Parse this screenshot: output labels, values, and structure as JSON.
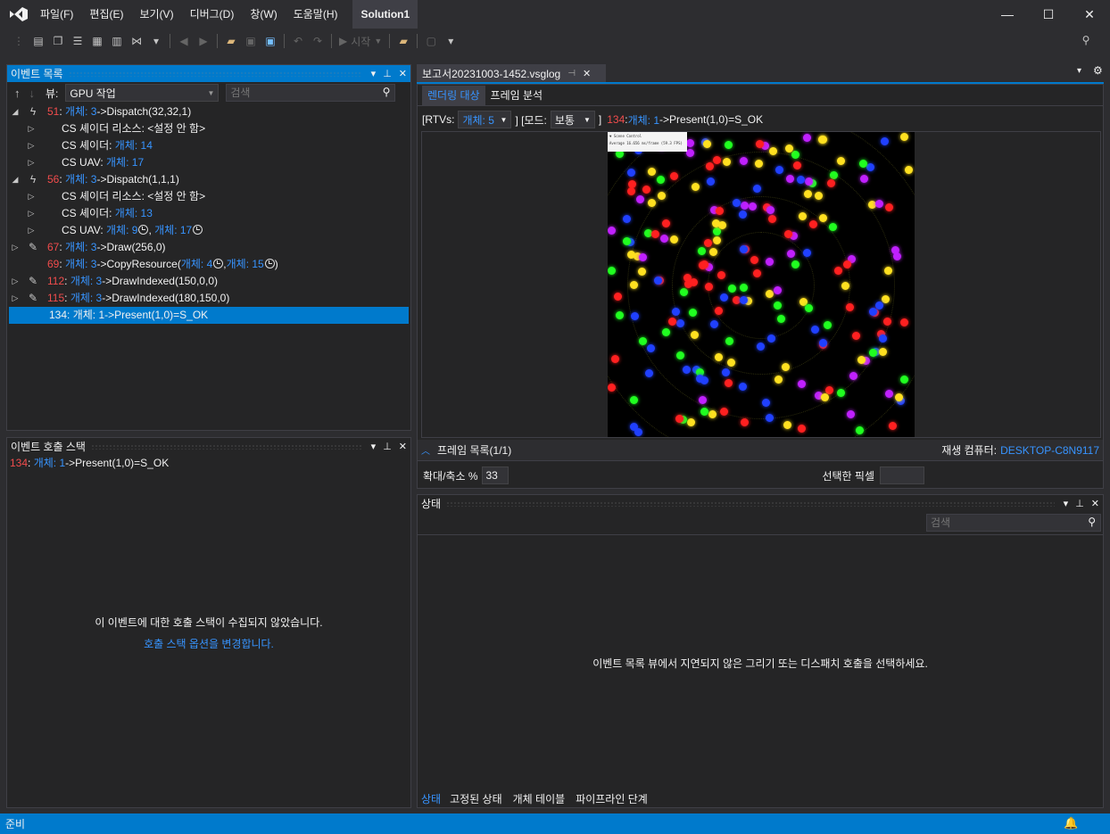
{
  "menu": [
    "파일(F)",
    "편집(E)",
    "보기(V)",
    "디버그(D)",
    "창(W)",
    "도움말(H)"
  ],
  "solution": "Solution1",
  "toolbar": {
    "start_label": "시작"
  },
  "event_list": {
    "title": "이벤트 목록",
    "view_label": "뷰:",
    "view_value": "GPU 작업",
    "search_placeholder": "검색",
    "items": [
      {
        "parts": [
          [
            "51",
            "red"
          ],
          [
            ": ",
            ""
          ],
          [
            "개체: 3",
            "blue"
          ],
          [
            "->Dispatch(32,32,1)",
            ""
          ]
        ]
      },
      {
        "parts": [
          [
            "CS 셰이더 리소스: <설정 안 함>",
            ""
          ]
        ]
      },
      {
        "parts": [
          [
            "CS 셰이더: ",
            ""
          ],
          [
            "개체: 14",
            "blue"
          ]
        ]
      },
      {
        "parts": [
          [
            "CS UAV: ",
            ""
          ],
          [
            "개체: 17",
            "blue"
          ]
        ]
      },
      {
        "parts": [
          [
            "56",
            "red"
          ],
          [
            ": ",
            ""
          ],
          [
            "개체: 3",
            "blue"
          ],
          [
            "->Dispatch(1,1,1)",
            ""
          ]
        ]
      },
      {
        "parts": [
          [
            "CS 셰이더 리소스: <설정 안 함>",
            ""
          ]
        ]
      },
      {
        "parts": [
          [
            "CS 셰이더: ",
            ""
          ],
          [
            "개체: 13",
            "blue"
          ]
        ]
      },
      {
        "parts": [
          [
            "CS UAV: ",
            ""
          ],
          [
            "개체: 9",
            "blue"
          ],
          [
            ", ",
            ""
          ],
          [
            "개체: 17",
            "blue"
          ]
        ]
      },
      {
        "parts": [
          [
            "67",
            "red"
          ],
          [
            ": ",
            ""
          ],
          [
            "개체: 3",
            "blue"
          ],
          [
            "->Draw(256,0)",
            ""
          ]
        ]
      },
      {
        "parts": [
          [
            "69",
            "red"
          ],
          [
            ": ",
            ""
          ],
          [
            "개체: 3",
            "blue"
          ],
          [
            "->CopyResource(",
            ""
          ],
          [
            "개체: 4",
            "blue"
          ],
          [
            ",",
            ""
          ],
          [
            "개체: 15",
            "blue"
          ],
          [
            ")",
            ""
          ]
        ]
      },
      {
        "parts": [
          [
            "112",
            "red"
          ],
          [
            ": ",
            ""
          ],
          [
            "개체: 3",
            "blue"
          ],
          [
            "->DrawIndexed(150,0,0)",
            ""
          ]
        ]
      },
      {
        "parts": [
          [
            "115",
            "red"
          ],
          [
            ": ",
            ""
          ],
          [
            "개체: 3",
            "blue"
          ],
          [
            "->DrawIndexed(180,150,0)",
            ""
          ]
        ]
      },
      {
        "parts": [
          [
            "134: 개체: 1->Present(1,0)=S_OK",
            ""
          ]
        ]
      }
    ]
  },
  "call_stack": {
    "title": "이벤트 호출 스택",
    "entry_num": "134",
    "entry_obj": "개체: 1",
    "entry_call": "->Present(1,0)=S_OK",
    "message": "이 이벤트에 대한 호출 스택이 수집되지 않았습니다.",
    "link": "호출 스택 옵션을 변경합니다."
  },
  "document": {
    "tab": "보고서20231003-1452.vsglog",
    "subtabs": [
      "렌더링 대상",
      "프레임 분석"
    ],
    "rtvs_label": "[RTVs:",
    "rtvs_value": "개체: 5",
    "mode_label": "] [모드:",
    "mode_value": "보통",
    "close_bracket": "]",
    "event_num": "134",
    "event_obj": "개체: 1",
    "event_call": "->Present(1,0)=S_OK",
    "overlay_title": "▼ Scene Control",
    "overlay_text": "Average 16.656 ms/frame (59.3 FPS)",
    "frame_list": "프레임 목록(1/1)",
    "playback_label": "재생 컴퓨터:",
    "playback_value": "DESKTOP-C8N9117",
    "zoom_label": "확대/축소 %",
    "zoom_value": "33",
    "pixel_label": "선택한 픽셀"
  },
  "state_panel": {
    "title": "상태",
    "search_placeholder": "검색",
    "message": "이벤트 목록 뷰에서 지연되지 않은 그리기 또는 디스패치 호출을 선택하세요.",
    "tabs": [
      "상태",
      "고정된 상태",
      "개체 테이블",
      "파이프라인 단계"
    ]
  },
  "status_bar": {
    "text": "준비"
  },
  "colors": {
    "accent": "#007acc",
    "error_red": "#f14c4c",
    "link_blue": "#3794ff"
  }
}
